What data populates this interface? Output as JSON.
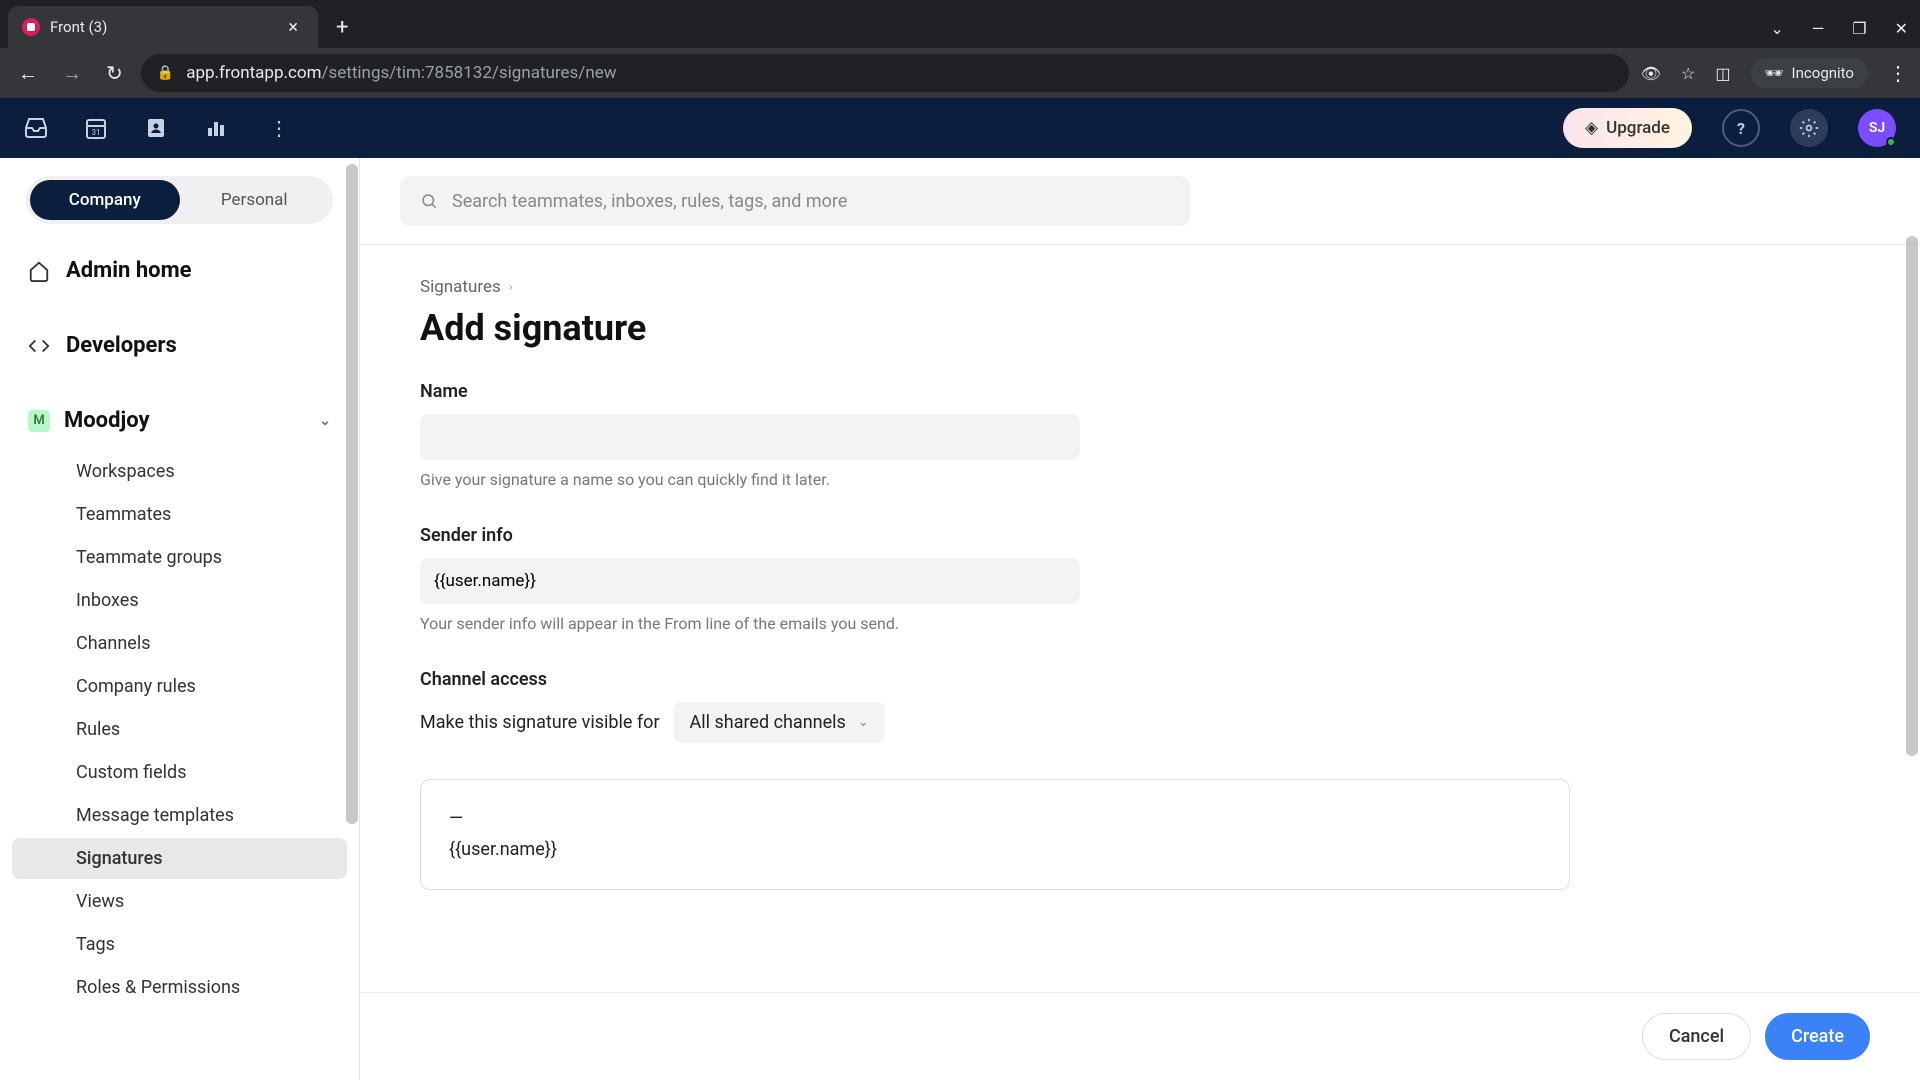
{
  "browser": {
    "tab_title": "Front (3)",
    "url_host": "app.frontapp.com",
    "url_path": "/settings/tim:7858132/signatures/new",
    "incognito_label": "Incognito"
  },
  "header": {
    "upgrade_label": "Upgrade",
    "avatar_initials": "SJ"
  },
  "sidebar": {
    "scope_tabs": {
      "company": "Company",
      "personal": "Personal"
    },
    "admin_home": "Admin home",
    "developers": "Developers",
    "org_name": "Moodjoy",
    "org_initial": "M",
    "items": [
      "Workspaces",
      "Teammates",
      "Teammate groups",
      "Inboxes",
      "Channels",
      "Company rules",
      "Rules",
      "Custom fields",
      "Message templates",
      "Signatures",
      "Views",
      "Tags",
      "Roles & Permissions"
    ],
    "active_index": 9
  },
  "search": {
    "placeholder": "Search teammates, inboxes, rules, tags, and more"
  },
  "page": {
    "breadcrumb": "Signatures",
    "title": "Add signature",
    "name": {
      "label": "Name",
      "value": "",
      "hint": "Give your signature a name so you can quickly find it later."
    },
    "sender": {
      "label": "Sender info",
      "value": "{{user.name}}",
      "hint": "Your sender info will appear in the From line of the emails you send."
    },
    "channel": {
      "label": "Channel access",
      "prompt": "Make this signature visible for",
      "selected": "All shared channels"
    },
    "editor": {
      "line1": "—",
      "line2": "{{user.name}}"
    },
    "actions": {
      "cancel": "Cancel",
      "create": "Create"
    }
  }
}
